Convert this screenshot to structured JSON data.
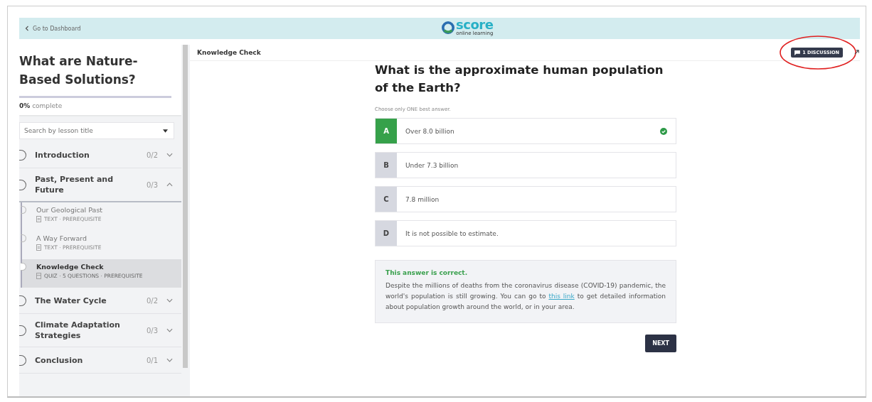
{
  "header": {
    "back_link": "Go to Dashboard",
    "logo": {
      "name": "score",
      "tagline": "online learning"
    }
  },
  "sidebar": {
    "course_title": "What are Nature-Based Solutions?",
    "progress": {
      "percent": "0%",
      "label": "complete",
      "level": 0
    },
    "search": {
      "placeholder": "Search by lesson title"
    },
    "sections": [
      {
        "title": "Introduction",
        "count": "0/2",
        "expanded": false
      },
      {
        "title": "Past, Present and Future",
        "count": "0/3",
        "expanded": true,
        "lessons": [
          {
            "title": "Our Geological Past",
            "meta": "TEXT · PREREQUISITE",
            "kind": "text",
            "selected": false
          },
          {
            "title": "A Way Forward",
            "meta": "TEXT · PREREQUISITE",
            "kind": "text",
            "selected": false
          },
          {
            "title": "Knowledge Check",
            "meta": "QUIZ · 5 QUESTIONS · PREREQUISITE",
            "kind": "quiz",
            "selected": true
          }
        ]
      },
      {
        "title": "The Water Cycle",
        "count": "0/2",
        "expanded": false
      },
      {
        "title": "Climate Adaptation Strategies",
        "count": "0/3",
        "expanded": false
      },
      {
        "title": "Conclusion",
        "count": "0/1",
        "expanded": false
      }
    ]
  },
  "content": {
    "title": "Knowledge Check",
    "discussion_button": "1 DISCUSSION",
    "question": "What is the approximate human population of the Earth?",
    "instruction": "Choose only ONE best answer.",
    "answers": [
      {
        "letter": "A",
        "text": "Over 8.0 billion",
        "selected": true,
        "correct": true
      },
      {
        "letter": "B",
        "text": "Under 7.3 billion",
        "selected": false,
        "correct": false
      },
      {
        "letter": "C",
        "text": "7.8 million",
        "selected": false,
        "correct": false
      },
      {
        "letter": "D",
        "text": "It is not possible to estimate.",
        "selected": false,
        "correct": false
      }
    ],
    "feedback": {
      "heading": "This answer is correct.",
      "text_before": "Despite the millions of deaths from the coronavirus disease (COVID-19) pandemic, the world's population is still growing. You can go to",
      "link": "this link",
      "text_after": "to get detailed information about population growth around the world, or in your area."
    },
    "next_button": "NEXT"
  }
}
